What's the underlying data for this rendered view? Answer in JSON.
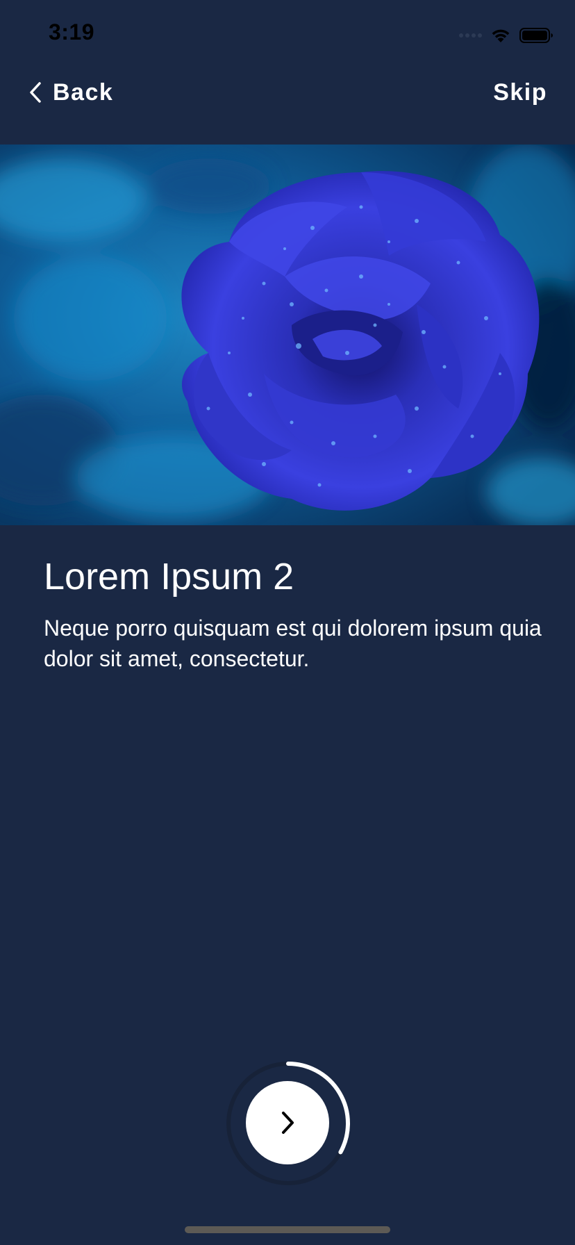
{
  "status_bar": {
    "time": "3:19",
    "icons": [
      "signal-dots-icon",
      "wifi-icon",
      "battery-icon"
    ]
  },
  "nav": {
    "back_label": "Back",
    "back_icon": "chevron-left-icon",
    "skip_label": "Skip"
  },
  "hero": {
    "image_subject": "blue rose with water droplets"
  },
  "content": {
    "title": "Lorem Ipsum 2",
    "body": "Neque porro quisquam est qui dolorem ipsum quia dolor sit amet, consectetur."
  },
  "next_button": {
    "icon": "chevron-right-icon",
    "progress": 0.33
  },
  "colors": {
    "background": "#1a2844",
    "text": "#ffffff",
    "button": "#ffffff",
    "progress_ring": "#ffffff",
    "rose": "#2a2fc8",
    "hero_background": "#0e5a96"
  }
}
